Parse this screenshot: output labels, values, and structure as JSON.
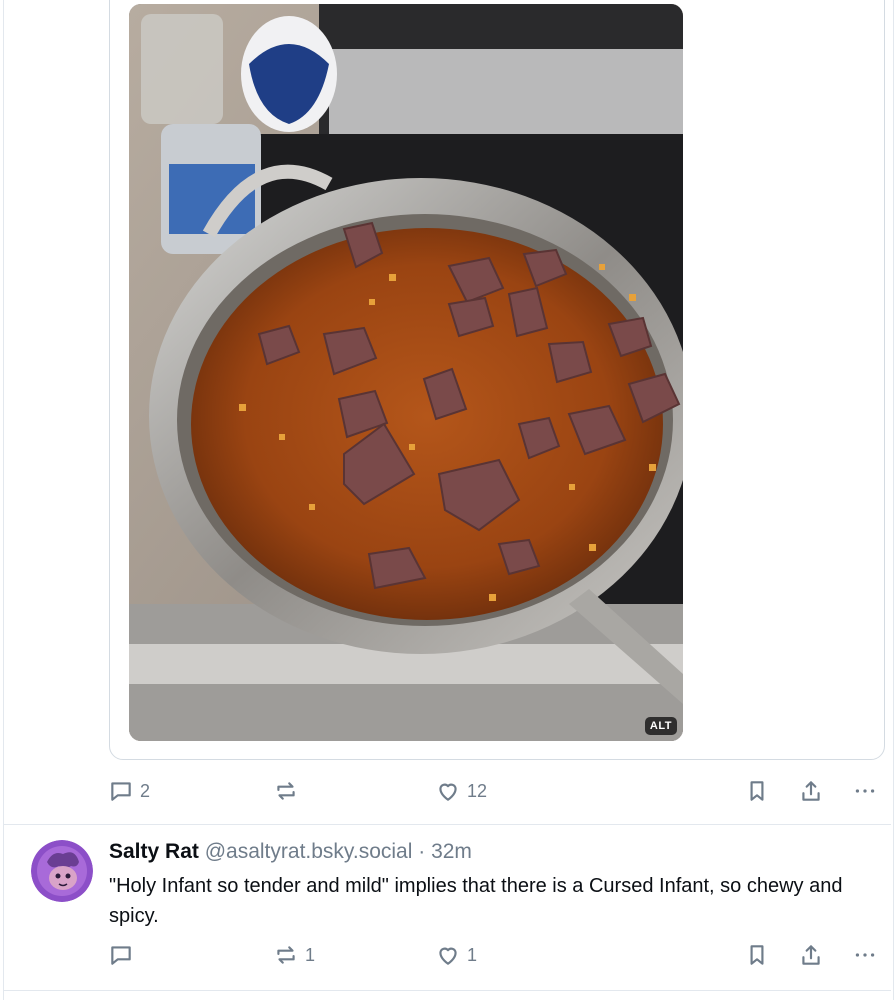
{
  "post": {
    "image_alt_badge": "ALT",
    "counts": {
      "replies": "2",
      "reposts": "",
      "likes": "12"
    }
  },
  "reply": {
    "display_name": "Salty Rat",
    "handle": "@asaltyrat.bsky.social",
    "separator": "·",
    "time": "32m",
    "text": "\"Holy Infant so tender and mild\" implies that there is a Cursed Infant, so chewy and spicy.",
    "counts": {
      "replies": "",
      "reposts": "1",
      "likes": "1"
    }
  },
  "icons": {
    "reply": "speech-bubble-icon",
    "repost": "repost-arrows-icon",
    "like": "heart-icon",
    "bookmark": "bookmark-icon",
    "share": "share-upload-icon",
    "more": "ellipsis-icon"
  },
  "colors": {
    "muted": "#6f7c8a",
    "border": "#d4dbe2",
    "text": "#0b0f14"
  }
}
